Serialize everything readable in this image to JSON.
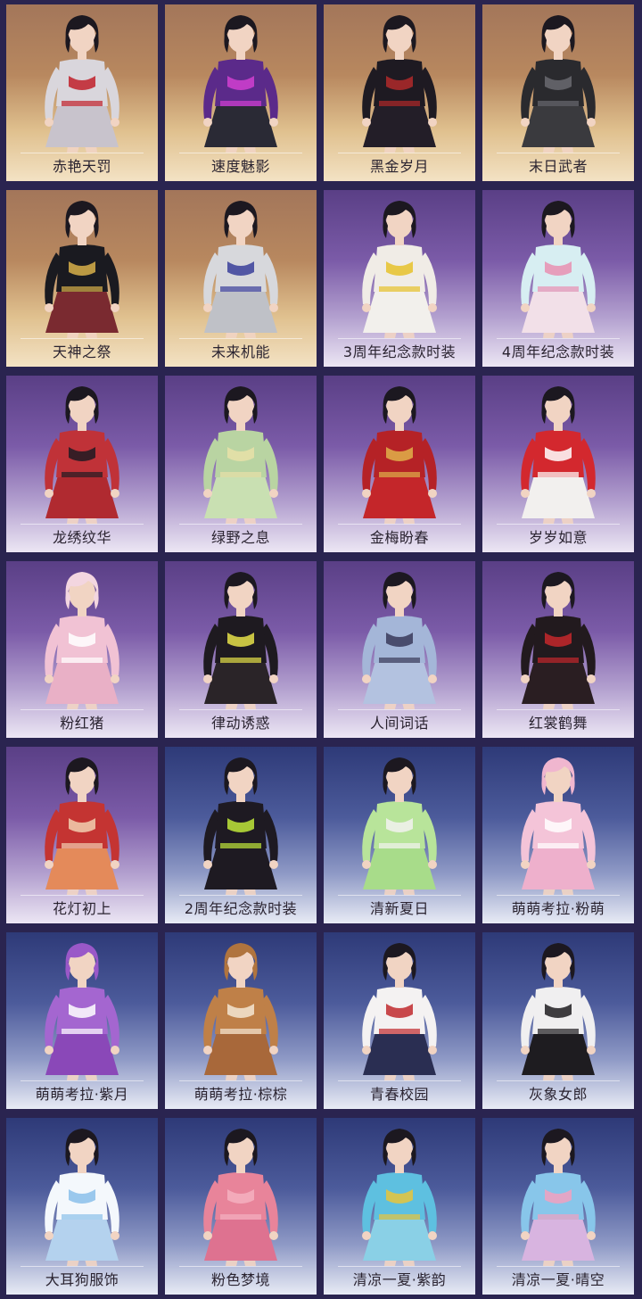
{
  "outfits": [
    {
      "name": "赤艳天罚",
      "theme": "gold",
      "hair": "#1c1820",
      "top": "#d9d6dc",
      "bottom": "#c8c3cc",
      "accent": "#c0202a"
    },
    {
      "name": "速度魅影",
      "theme": "gold",
      "hair": "#1c1820",
      "top": "#5b2a8a",
      "bottom": "#2a2a35",
      "accent": "#d23fd0"
    },
    {
      "name": "黑金岁月",
      "theme": "gold",
      "hair": "#1c1820",
      "top": "#1e1a22",
      "bottom": "#231e28",
      "accent": "#b02a2a"
    },
    {
      "name": "末日武者",
      "theme": "gold",
      "hair": "#1c1820",
      "top": "#2a2a2e",
      "bottom": "#3a3a3e",
      "accent": "#6a6a70"
    },
    {
      "name": "天神之祭",
      "theme": "gold",
      "hair": "#1c1820",
      "top": "#1a1a20",
      "bottom": "#7a2a30",
      "accent": "#d8b04a"
    },
    {
      "name": "未来机能",
      "theme": "gold",
      "hair": "#1c1820",
      "top": "#d7d8dc",
      "bottom": "#bfc1c7",
      "accent": "#3a3f9a"
    },
    {
      "name": "3周年纪念款时装",
      "theme": "purple",
      "hair": "#1c1820",
      "top": "#f0ece6",
      "bottom": "#f2f0ec",
      "accent": "#e6c22a"
    },
    {
      "name": "4周年纪念款时装",
      "theme": "purple",
      "hair": "#1c1820",
      "top": "#d7eef2",
      "bottom": "#f2e0e8",
      "accent": "#e98fb2"
    },
    {
      "name": "龙绣纹华",
      "theme": "purple",
      "hair": "#1c1820",
      "top": "#c03238",
      "bottom": "#b02a30",
      "accent": "#1e1a22"
    },
    {
      "name": "绿野之息",
      "theme": "purple",
      "hair": "#1c1820",
      "top": "#b9d4a2",
      "bottom": "#c9e0b2",
      "accent": "#e8e0a8"
    },
    {
      "name": "金梅盼春",
      "theme": "purple",
      "hair": "#1c1820",
      "top": "#b52226",
      "bottom": "#c4262a",
      "accent": "#e0b04a"
    },
    {
      "name": "岁岁如意",
      "theme": "purple",
      "hair": "#1c1820",
      "top": "#d3282e",
      "bottom": "#f2f0ee",
      "accent": "#ffffff"
    },
    {
      "name": "粉红猪",
      "theme": "purple",
      "hair": "#f3d6e0",
      "top": "#f1c2d4",
      "bottom": "#e9b0c6",
      "accent": "#ffffff"
    },
    {
      "name": "律动诱惑",
      "theme": "purple",
      "hair": "#1c1820",
      "top": "#1e1a20",
      "bottom": "#2a2428",
      "accent": "#e6e24a"
    },
    {
      "name": "人间词话",
      "theme": "purple",
      "hair": "#1c1820",
      "top": "#a4b6d8",
      "bottom": "#b3c2e0",
      "accent": "#3a3a5a"
    },
    {
      "name": "红裳鹤舞",
      "theme": "purple",
      "hair": "#1c1820",
      "top": "#221a1e",
      "bottom": "#2a1e22",
      "accent": "#c4282c"
    },
    {
      "name": "花灯初上",
      "theme": "purple",
      "hair": "#1c1820",
      "top": "#c43432",
      "bottom": "#e48a5a",
      "accent": "#f2d0b0"
    },
    {
      "name": "2周年纪念款时装",
      "theme": "blue",
      "hair": "#1c1820",
      "top": "#1e1a22",
      "bottom": "#1e1a22",
      "accent": "#c0e83a"
    },
    {
      "name": "清新夏日",
      "theme": "blue",
      "hair": "#1c1820",
      "top": "#b8e49a",
      "bottom": "#a8dc8a",
      "accent": "#f2f2f0"
    },
    {
      "name": "萌萌考拉·粉萌",
      "theme": "blue",
      "hair": "#f0b6cf",
      "top": "#f4c4d8",
      "bottom": "#eeb0cc",
      "accent": "#ffffff"
    },
    {
      "name": "萌萌考拉·紫月",
      "theme": "blue",
      "hair": "#9a58c8",
      "top": "#a466d0",
      "bottom": "#8a48b8",
      "accent": "#ffffff"
    },
    {
      "name": "萌萌考拉·棕棕",
      "theme": "blue",
      "hair": "#b0743e",
      "top": "#bf8048",
      "bottom": "#a8683a",
      "accent": "#f3e6d4"
    },
    {
      "name": "青春校园",
      "theme": "blue",
      "hair": "#1c1820",
      "top": "#f4f2f2",
      "bottom": "#2a2e52",
      "accent": "#c02a2e"
    },
    {
      "name": "灰象女郎",
      "theme": "blue",
      "hair": "#1c1820",
      "top": "#f0eff0",
      "bottom": "#1e1c20",
      "accent": "#1e1c20"
    },
    {
      "name": "大耳狗服饰",
      "theme": "blue",
      "hair": "#1c1820",
      "top": "#f4f8fc",
      "bottom": "#b4d2ee",
      "accent": "#8ac0ea"
    },
    {
      "name": "粉色梦境",
      "theme": "blue",
      "hair": "#1c1820",
      "top": "#e8849a",
      "bottom": "#de7290",
      "accent": "#f4b0c0"
    },
    {
      "name": "清凉一夏·紫韵",
      "theme": "blue",
      "hair": "#1c1820",
      "top": "#5ec0e0",
      "bottom": "#8ad0e6",
      "accent": "#e8c43a"
    },
    {
      "name": "清凉一夏·晴空",
      "theme": "blue",
      "hair": "#1c1820",
      "top": "#88c6ea",
      "bottom": "#d8b4e0",
      "accent": "#f2a0c0"
    }
  ]
}
